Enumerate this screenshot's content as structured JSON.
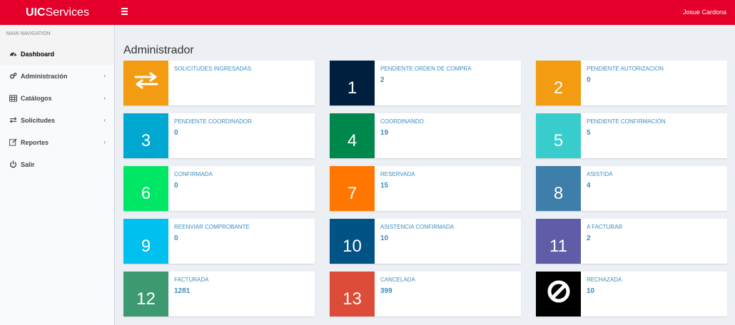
{
  "header": {
    "logo_bold": "UIC",
    "logo_rest": "Services",
    "user_name": "Josue Cardona",
    "color": "#e4002b"
  },
  "sidebar": {
    "header": "MAIN NAVIGATION",
    "items": [
      {
        "label": "Dashboard",
        "icon": "dashboard-icon"
      },
      {
        "label": "Administración",
        "icon": "cogs-icon"
      },
      {
        "label": "Catálogos",
        "icon": "table-icon"
      },
      {
        "label": "Solicitudes",
        "icon": "exchange-icon"
      },
      {
        "label": "Reportes",
        "icon": "edit-icon"
      },
      {
        "label": "Salir",
        "icon": "power-icon"
      }
    ]
  },
  "main": {
    "title": "Administrador",
    "cards": [
      {
        "box": "",
        "icon": "exchange-icon",
        "label": "SOLICITUDES INGRESADAS",
        "value": "",
        "color": "#f39c12"
      },
      {
        "box": "1",
        "label": "PENDIENTE ORDEN DE COMPRA",
        "value": "2",
        "color": "#001f3f"
      },
      {
        "box": "2",
        "label": "PENDIENTE AUTORIZACION",
        "value": "0",
        "color": "#f39c12"
      },
      {
        "box": "3",
        "label": "PENDIENTE COORDINADOR",
        "value": "0",
        "color": "#00a7d0"
      },
      {
        "box": "4",
        "label": "COORDINANDO",
        "value": "19",
        "color": "#00874b"
      },
      {
        "box": "5",
        "label": "PENDIENTE CONFIRMACIÓN",
        "value": "5",
        "color": "#39cccc"
      },
      {
        "box": "6",
        "label": "CONFIRMADA",
        "value": "0",
        "color": "#00e765"
      },
      {
        "box": "7",
        "label": "RESERVADA",
        "value": "15",
        "color": "#ff7701"
      },
      {
        "box": "8",
        "label": "ASISTIDA",
        "value": "4",
        "color": "#3d7eab"
      },
      {
        "box": "9",
        "label": "REENVIAR COMPROBANTE",
        "value": "0",
        "color": "#00c0ef"
      },
      {
        "box": "10",
        "label": "ASISTENCIA CONFIRMADA",
        "value": "10",
        "color": "#005384"
      },
      {
        "box": "11",
        "label": "A FACTURAR",
        "value": "2",
        "color": "#605ca8"
      },
      {
        "box": "12",
        "label": "FACTURADA",
        "value": "1281",
        "color": "#3d9970"
      },
      {
        "box": "13",
        "label": "CANCELADA",
        "value": "399",
        "color": "#dd4b39"
      },
      {
        "box": "",
        "icon": "ban-icon",
        "label": "RECHAZADA",
        "value": "10",
        "color": "#000000"
      }
    ]
  }
}
